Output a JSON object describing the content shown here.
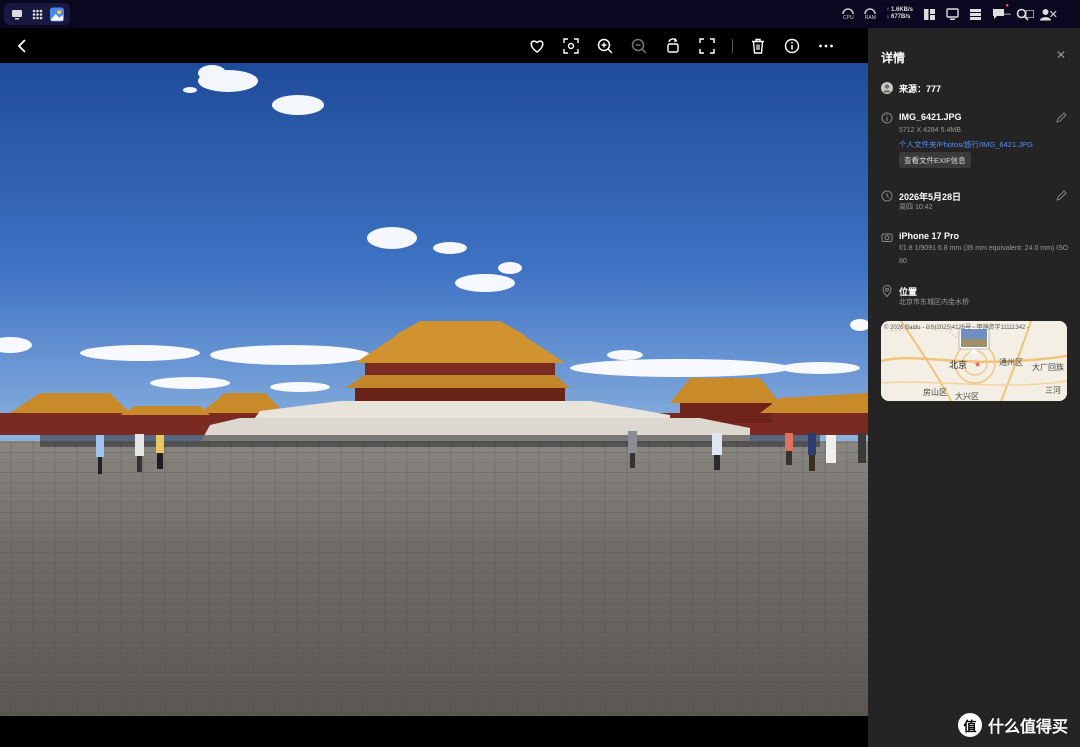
{
  "system_bar": {
    "cpu_label": "CPU",
    "ram_label": "RAM",
    "upload": "↑ 1.6KB/s",
    "download": "↓ 677B/s",
    "notification_badge": "●"
  },
  "window_controls": {
    "minimize": "—",
    "maximize": "☐",
    "close": "✕"
  },
  "viewer": {
    "icons": [
      "chevron-left",
      "heart",
      "scan",
      "zoom-in",
      "zoom-out",
      "rotate",
      "fullscreen",
      "trash",
      "info",
      "more"
    ]
  },
  "panel": {
    "title": "详情",
    "close": "✕",
    "source": "来源：777",
    "file_name": "IMG_6421.JPG",
    "file_meta": "5712 X 4284 5.4MB",
    "file_path": "个人文件夹/Photos/旅行/IMG_6421.JPG",
    "exif_button": "查看文件EXIF信息",
    "date": "2026年5月28日",
    "time": "周四 10:42",
    "device": "iPhone 17 Pro",
    "camera_meta": "f/1.8 1/9091 6.8 mm (35 mm equivalent: 24.0 mm) ISO 80",
    "location_title": "位置",
    "location_address": "北京市东城区内金水桥",
    "map_copyright": "© 2026 Baidu - GS(2025)4125号 - 甲测资字11111342 -",
    "map_labels": {
      "beijing": "北京",
      "tongzhou": "通州区",
      "fangshan": "房山区",
      "daxing": "大兴区",
      "dachang": "大厂回族",
      "sanhe": "三河"
    }
  },
  "watermark": {
    "logo_char": "值",
    "text": "什么值得买"
  },
  "colors": {
    "panel_bg": "#242424",
    "link": "#5b8ff0",
    "sky": "#2f5fb0"
  }
}
